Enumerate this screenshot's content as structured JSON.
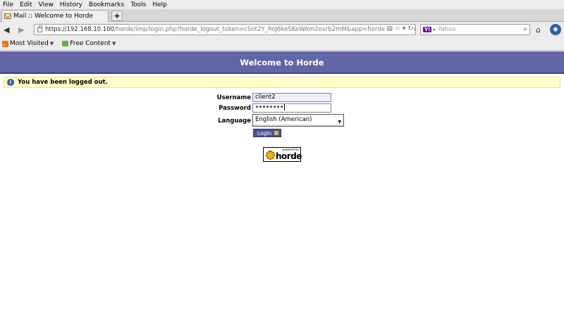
{
  "menubar": {
    "items": [
      "File",
      "Edit",
      "View",
      "History",
      "Bookmarks",
      "Tools",
      "Help"
    ]
  },
  "tab": {
    "title": "Mail :: Welcome to Horde",
    "new_tab": "+"
  },
  "navbar": {
    "url_host": "https://192.168.10.100",
    "url_rest": "/horde/imp/login.php?horde_logout_token=cSnt2Y_RoJ6keSKeWAm2ovrb2mM&app=horde&logout_rea",
    "search_engine": "Y!",
    "search_placeholder": "Yahoo"
  },
  "bookmarks": {
    "items": [
      {
        "label": "Most Visited",
        "icon": "rss-icon"
      },
      {
        "label": "Free Content",
        "icon": "folder-icon"
      }
    ]
  },
  "page": {
    "header": "Welcome to Horde",
    "notice": "You have been logged out.",
    "colors": {
      "header_bg": "#6166a7",
      "notice_bg": "#ffffcc",
      "button_bg": "#4c5494"
    }
  },
  "login": {
    "username_label": "Username",
    "username_value": "client2",
    "password_label": "Password",
    "password_value": "••••••••",
    "language_label": "Language",
    "language_value": "English (American)",
    "submit_label": "Login"
  },
  "logo": {
    "powered": "powered by",
    "word": "horde"
  }
}
